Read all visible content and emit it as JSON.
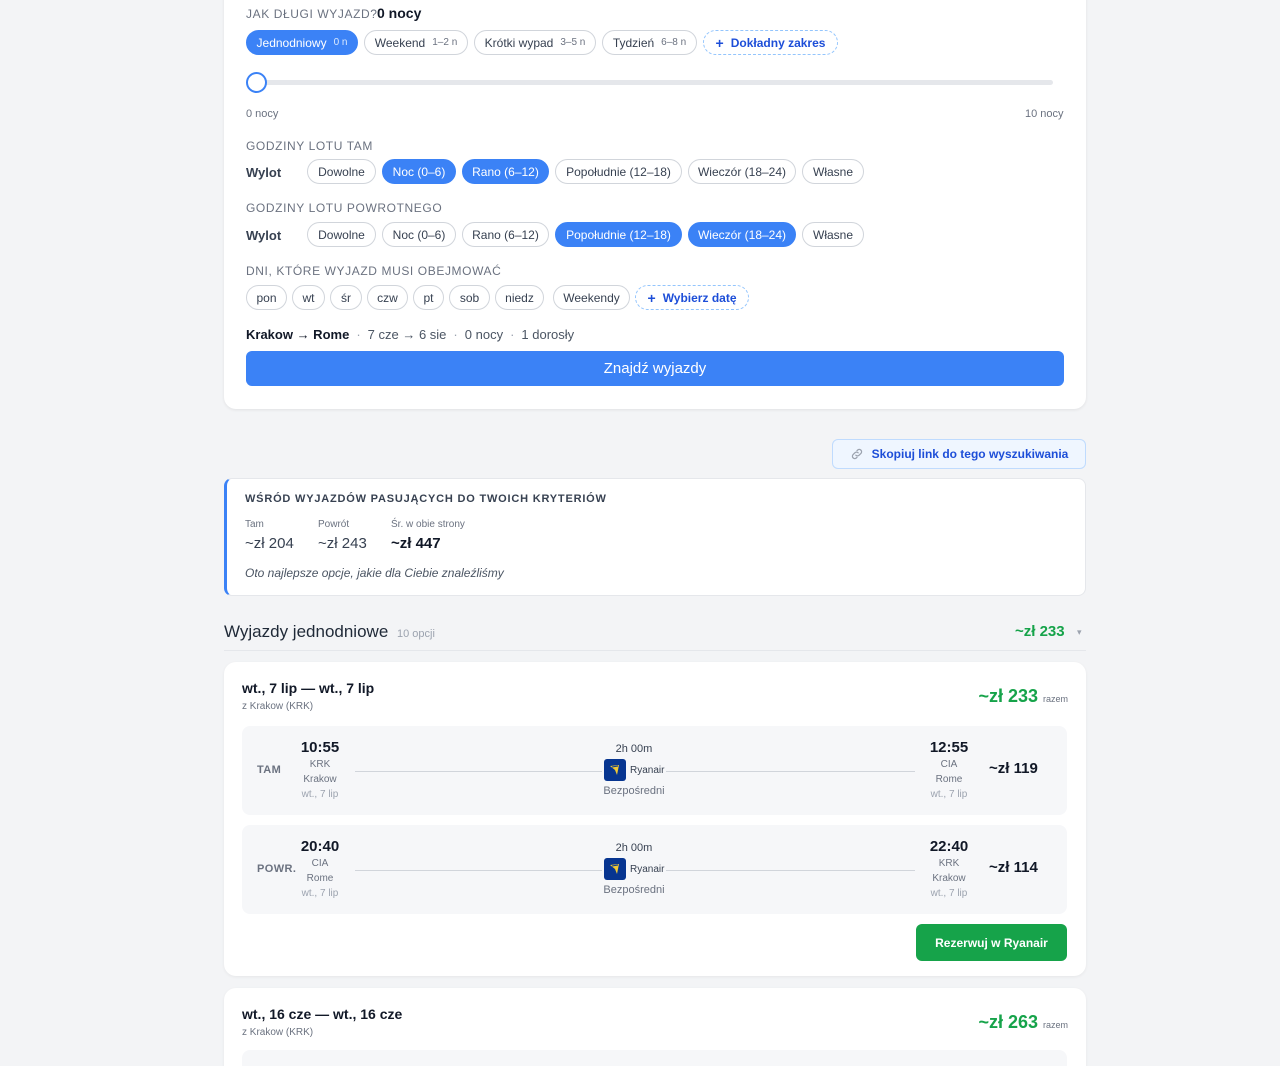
{
  "duration": {
    "label": "JAK DŁUGI WYJAZD?",
    "value": "0 nocy",
    "presets": [
      {
        "label": "Jednodniowy",
        "sub": "0 n",
        "active": true
      },
      {
        "label": "Weekend",
        "sub": "1–2 n",
        "active": false
      },
      {
        "label": "Krótki wypad",
        "sub": "3–5 n",
        "active": false
      },
      {
        "label": "Tydzień",
        "sub": "6–8 n",
        "active": false
      }
    ],
    "exact_range": "Dokładny zakres",
    "slider_min": "0 nocy",
    "slider_max": "10 nocy",
    "slider_fraction": 0
  },
  "outbound_times": {
    "label": "GODZINY LOTU TAM",
    "row_label": "Wylot",
    "options": [
      {
        "label": "Dowolne",
        "active": false
      },
      {
        "label": "Noc (0–6)",
        "active": true
      },
      {
        "label": "Rano (6–12)",
        "active": true
      },
      {
        "label": "Popołudnie (12–18)",
        "active": false
      },
      {
        "label": "Wieczór (18–24)",
        "active": false
      },
      {
        "label": "Własne",
        "active": false
      }
    ]
  },
  "return_times": {
    "label": "GODZINY LOTU POWROTNEGO",
    "row_label": "Wylot",
    "options": [
      {
        "label": "Dowolne",
        "active": false
      },
      {
        "label": "Noc (0–6)",
        "active": false
      },
      {
        "label": "Rano (6–12)",
        "active": false
      },
      {
        "label": "Popołudnie (12–18)",
        "active": true
      },
      {
        "label": "Wieczór (18–24)",
        "active": true
      },
      {
        "label": "Własne",
        "active": false
      }
    ]
  },
  "days": {
    "label": "DNI, KTÓRE WYJAZD MUSI OBEJMOWAĆ",
    "options": [
      "pon",
      "wt",
      "śr",
      "czw",
      "pt",
      "sob",
      "niedz",
      "Weekendy"
    ],
    "pick_date": "Wybierz datę"
  },
  "query_summary": {
    "route": "Krakow → Rome",
    "sep": "·",
    "dates": "7 cze → 6 sie",
    "nights": "0 nocy",
    "pax": "1 dorosły"
  },
  "search_button": "Znajdź wyjazdy",
  "copy_link": "Skopiuj link do tego wyszukiwania",
  "summary": {
    "title": "WŚRÓD WYJAZDÓW PASUJĄCYCH DO TWOICH KRYTERIÓW",
    "stats": [
      {
        "label": "Tam",
        "value": "~zł 204",
        "bold": false
      },
      {
        "label": "Powrót",
        "value": "~zł 243",
        "bold": false
      },
      {
        "label": "Śr. w obie strony",
        "value": "~zł 447",
        "bold": true
      }
    ],
    "note": "Oto najlepsze opcje, jakie dla Ciebie znaleźliśmy"
  },
  "group": {
    "title": "Wyjazdy jednodniowe",
    "count": "10 opcji",
    "price": "~zł 233",
    "toggle": "▾"
  },
  "trips": [
    {
      "dates": "wt., 7 lip — wt., 7 lip",
      "from": "z Krakow (KRK)",
      "total": "~zł 233",
      "total_label": "razem",
      "legs": [
        {
          "side": "TAM",
          "dep_time": "10:55",
          "dep_code": "KRK",
          "dep_city": "Krakow",
          "dep_date": "wt., 7 lip",
          "duration": "2h 00m",
          "airline": "Ryanair",
          "stops": "Bezpośredni",
          "arr_time": "12:55",
          "arr_code": "CIA",
          "arr_city": "Rome",
          "arr_date": "wt., 7 lip",
          "price": "~zł 119"
        },
        {
          "side": "POWR.",
          "dep_time": "20:40",
          "dep_code": "CIA",
          "dep_city": "Rome",
          "dep_date": "wt., 7 lip",
          "duration": "2h 00m",
          "airline": "Ryanair",
          "stops": "Bezpośredni",
          "arr_time": "22:40",
          "arr_code": "KRK",
          "arr_city": "Krakow",
          "arr_date": "wt., 7 lip",
          "price": "~zł 114"
        }
      ],
      "book": "Rezerwuj w Ryanair"
    },
    {
      "dates": "wt., 16 cze — wt., 16 cze",
      "from": "z Krakow (KRK)",
      "total": "~zł 263",
      "total_label": "razem"
    }
  ],
  "colors": {
    "accent": "#3b82f6",
    "price_green": "#16a34a",
    "book_green": "#16a34a"
  }
}
